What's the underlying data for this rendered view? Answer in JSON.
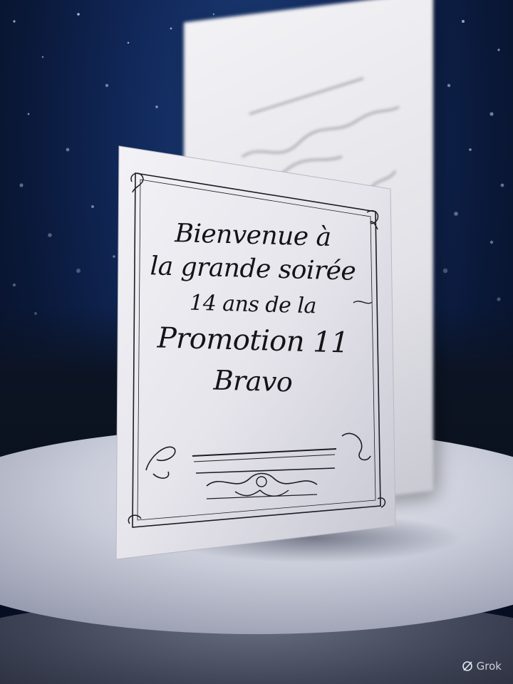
{
  "card": {
    "line1": "Bienvenue à",
    "line2": "la grande soirée",
    "line3": "14 ans  de  la",
    "line4": "Promotion 11",
    "line5": "Bravo"
  },
  "watermark": {
    "label": "Grok",
    "icon": "grok-logo-icon"
  },
  "colors": {
    "sky": "#11285a",
    "card": "#e9e8ee",
    "ink": "#141418"
  }
}
